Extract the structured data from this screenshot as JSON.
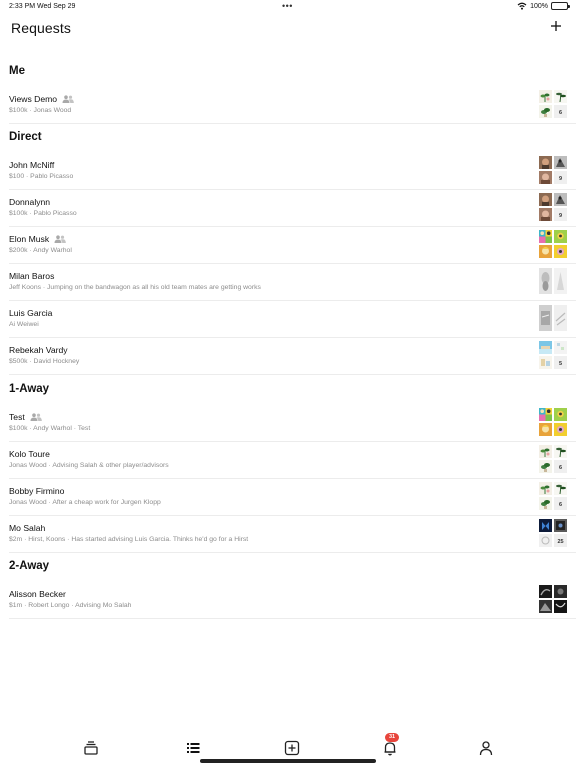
{
  "status": {
    "time_date": "2:33 PM   Wed Sep 29",
    "dots": "•••",
    "battery": "100%"
  },
  "header": {
    "title": "Requests"
  },
  "sections": [
    {
      "title": "Me",
      "rows": [
        {
          "name": "Views Demo",
          "group": true,
          "sub": "$100k · Jonas Wood",
          "count": "6",
          "thumbs": "plant"
        }
      ]
    },
    {
      "title": "Direct",
      "rows": [
        {
          "name": "John McNiff",
          "group": false,
          "sub": "$100 · Pablo Picasso",
          "count": "9",
          "thumbs": "picasso"
        },
        {
          "name": "Donnalynn",
          "group": false,
          "sub": "$100k · Pablo Picasso",
          "count": "9",
          "thumbs": "picasso"
        },
        {
          "name": "Elon Musk",
          "group": true,
          "sub": "$200k · Andy Warhol",
          "count": "",
          "thumbs": "warhol"
        },
        {
          "name": "Milan Baros",
          "group": false,
          "sub": "Jeff Koons · Jumping on the bandwagon as all his old team mates are getting works",
          "count": "",
          "thumbs": "koons"
        },
        {
          "name": " Luis Garcia",
          "group": false,
          "sub": "Ai Weiwei",
          "count": "",
          "thumbs": "weiwei"
        },
        {
          "name": "Rebekah Vardy",
          "group": false,
          "sub": "$500k · David Hockney",
          "count": "5",
          "thumbs": "hockney"
        }
      ]
    },
    {
      "title": "1-Away",
      "rows": [
        {
          "name": "Test",
          "group": true,
          "sub": "$100k · Andy Warhol · Test",
          "count": "",
          "thumbs": "warhol"
        },
        {
          "name": "Kolo Toure",
          "group": false,
          "sub": "Jonas Wood · Advising Salah & other player/advisors",
          "count": "6",
          "thumbs": "plant"
        },
        {
          "name": "Bobby Firmino",
          "group": false,
          "sub": "Jonas Wood · After a cheap work for Jurgen Klopp",
          "count": "6",
          "thumbs": "plant"
        },
        {
          "name": "Mo Salah",
          "group": false,
          "sub": "$2m · Hirst, Koons · Has started advising Luis Garcia. Thinks he'd go for a Hirst",
          "count": "25",
          "thumbs": "hirst"
        }
      ]
    },
    {
      "title": "2-Away",
      "rows": [
        {
          "name": "Alisson Becker",
          "group": false,
          "sub": "$1m · Robert Longo · Advising Mo Salah",
          "count": "",
          "thumbs": "longo"
        }
      ]
    }
  ],
  "tabbar": {
    "tabs": [
      {
        "name": "collections",
        "icon": "stack-icon"
      },
      {
        "name": "requests",
        "icon": "list-icon"
      },
      {
        "name": "add",
        "icon": "plus-square-icon"
      },
      {
        "name": "notifications",
        "icon": "bell-icon"
      },
      {
        "name": "profile",
        "icon": "person-icon"
      }
    ],
    "badge": "31"
  },
  "colors": {
    "badge": "#e8453c",
    "subtext": "#8c8c8c",
    "divider": "#ececec"
  }
}
